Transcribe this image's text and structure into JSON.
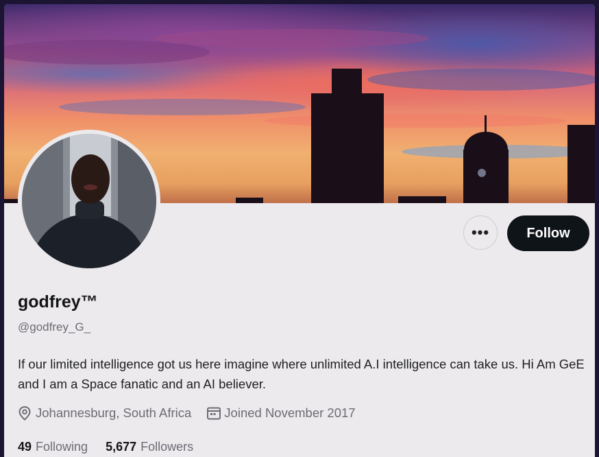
{
  "profile": {
    "display_name": "godfrey™",
    "handle": "@godfrey_G_",
    "bio": "If our limited intelligence got us here imagine where unlimited A.I intelligence  can take us. Hi Am GeE and I am a Space fanatic and an AI believer.",
    "location": "Johannesburg, South Africa",
    "joined": "Joined November 2017"
  },
  "actions": {
    "more_label": "•••",
    "follow_label": "Follow"
  },
  "stats": {
    "following_count": "49",
    "following_label": "Following",
    "followers_count": "5,677",
    "followers_label": "Followers"
  },
  "icons": {
    "location": "location-pin-icon",
    "joined": "calendar-icon"
  },
  "colors": {
    "follow_button_bg": "#0f1419",
    "page_bg": "#eceaed",
    "muted_text": "#6e6a73"
  }
}
